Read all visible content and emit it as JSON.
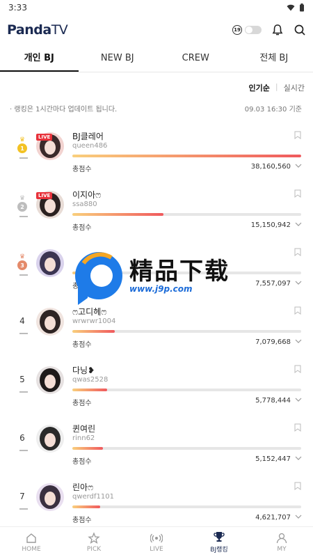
{
  "status_bar": {
    "time": "3:33"
  },
  "header": {
    "logo_main": "Panda",
    "logo_tv": "TV",
    "age_badge": "19"
  },
  "tabs": [
    {
      "label": "개인 BJ",
      "active": true
    },
    {
      "label": "NEW BJ",
      "active": false
    },
    {
      "label": "CREW",
      "active": false
    },
    {
      "label": "전체 BJ",
      "active": false
    }
  ],
  "sort": {
    "active": "인기순",
    "other": "실시간"
  },
  "info": {
    "notice": "· 랭킹은 1시간마다 업데이트 됩니다.",
    "updated": "09.03 16:30 기준"
  },
  "score_label": "총점수",
  "live_label": "LIVE",
  "rankings": [
    {
      "rank": "1",
      "medal": "gold",
      "live": true,
      "name": "BJ클레어",
      "id": "queen486",
      "score": "38,160,560",
      "progress": 1.0
    },
    {
      "rank": "2",
      "medal": "silver",
      "live": true,
      "name": "이지아ෆ",
      "id": "ssa880",
      "score": "15,150,942",
      "progress": 0.397
    },
    {
      "rank": "3",
      "medal": "bronze",
      "live": false,
      "name": "",
      "id": "",
      "score": "7,557,097",
      "progress": 0.198
    },
    {
      "rank": "4",
      "medal": "",
      "live": false,
      "name": "ෆ고디헤ෆ",
      "id": "wrwrwr1004",
      "score": "7,079,668",
      "progress": 0.186
    },
    {
      "rank": "5",
      "medal": "",
      "live": false,
      "name": "다닝❥",
      "id": "qwas2528",
      "score": "5,778,444",
      "progress": 0.151
    },
    {
      "rank": "6",
      "medal": "",
      "live": false,
      "name": "퀸여린",
      "id": "rinn62",
      "score": "5,152,447",
      "progress": 0.135
    },
    {
      "rank": "7",
      "medal": "",
      "live": false,
      "name": "린아ෆ",
      "id": "qwerdf1101",
      "score": "4,621,707",
      "progress": 0.121
    }
  ],
  "watermark": {
    "title": "精品下载",
    "url": "www.j9p.com"
  },
  "bottom_nav": [
    {
      "label": "HOME",
      "icon": "home-icon",
      "active": false
    },
    {
      "label": "PICK",
      "icon": "star-icon",
      "active": false
    },
    {
      "label": "LIVE",
      "icon": "live-broadcast-icon",
      "active": false
    },
    {
      "label": "BJ랭킹",
      "icon": "trophy-icon",
      "active": true
    },
    {
      "label": "MY",
      "icon": "person-icon",
      "active": false
    }
  ],
  "colors": {
    "brand": "#1b2a52",
    "live": "#e8313a",
    "bar_start": "#f9cf7c",
    "bar_end": "#f0595d"
  }
}
